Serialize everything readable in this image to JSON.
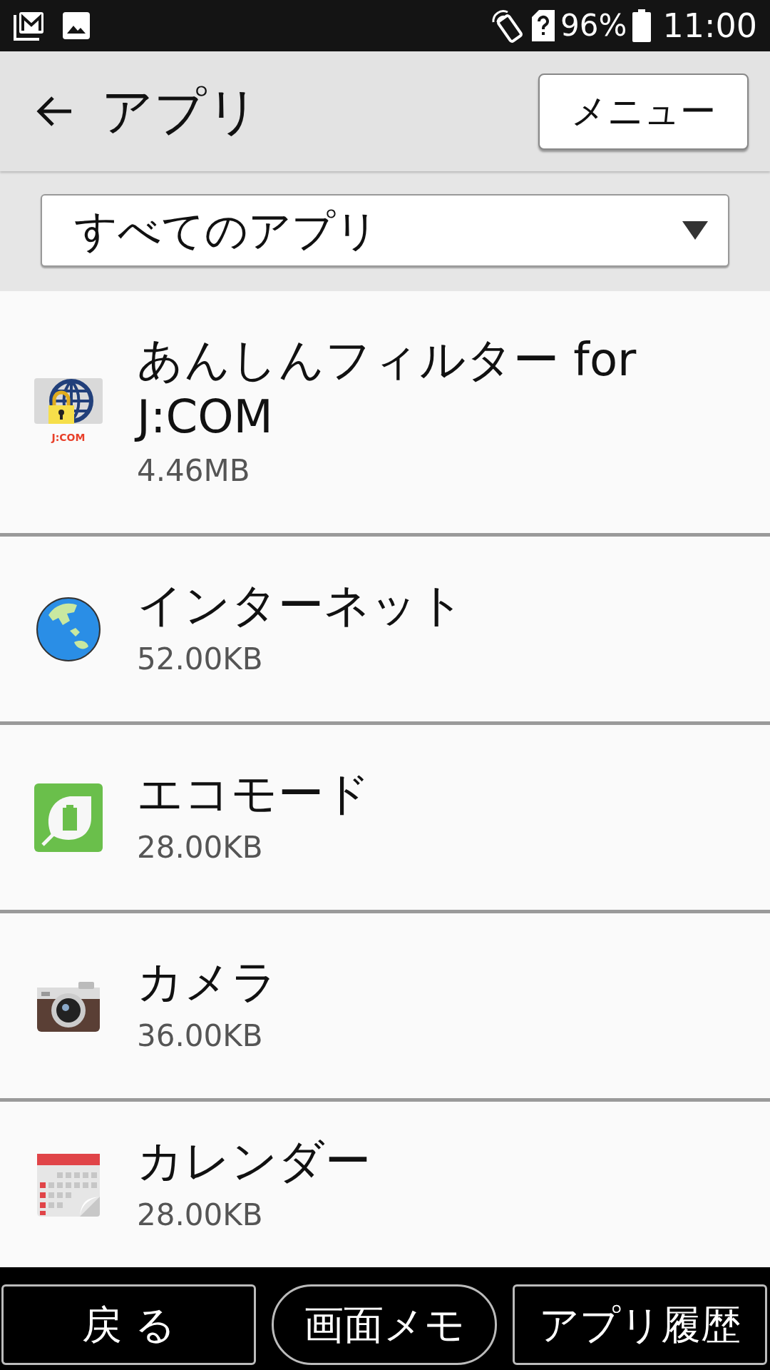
{
  "status_bar": {
    "battery_text": "96%",
    "time": "11:00"
  },
  "header": {
    "title": "アプリ",
    "menu_button": "メニュー"
  },
  "filter": {
    "value": "すべてのアプリ"
  },
  "apps": [
    {
      "name": "あんしんフィルター for J:COM",
      "size": "4.46MB",
      "kind": "filter",
      "icon_text": "J:COM"
    },
    {
      "name": "インターネット",
      "size": "52.00KB",
      "kind": "globe"
    },
    {
      "name": "エコモード",
      "size": "28.00KB",
      "kind": "eco"
    },
    {
      "name": "カメラ",
      "size": "36.00KB",
      "kind": "camera"
    },
    {
      "name": "カレンダー",
      "size": "28.00KB",
      "kind": "calendar"
    }
  ],
  "nav_buttons": [
    {
      "label": "戻 る",
      "kind": "rect"
    },
    {
      "label": "画面メモ",
      "kind": "pill"
    },
    {
      "label": "アプリ履歴",
      "kind": "rect"
    }
  ]
}
